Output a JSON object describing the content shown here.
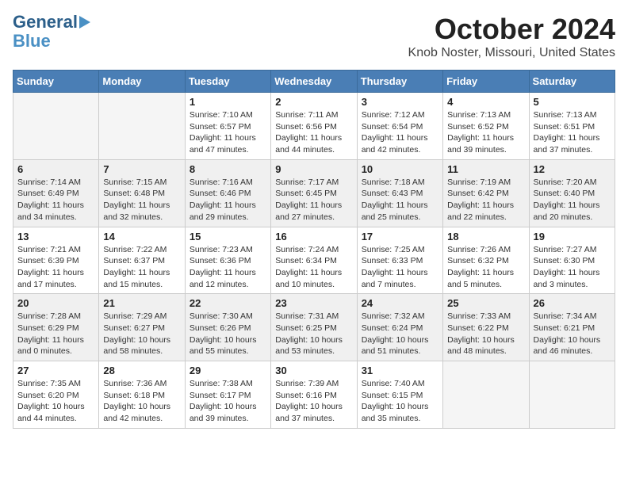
{
  "header": {
    "logo_line1": "General",
    "logo_line2": "Blue",
    "month": "October 2024",
    "location": "Knob Noster, Missouri, United States"
  },
  "days_of_week": [
    "Sunday",
    "Monday",
    "Tuesday",
    "Wednesday",
    "Thursday",
    "Friday",
    "Saturday"
  ],
  "weeks": [
    {
      "shaded": false,
      "days": [
        {
          "num": "",
          "info": ""
        },
        {
          "num": "",
          "info": ""
        },
        {
          "num": "1",
          "info": "Sunrise: 7:10 AM\nSunset: 6:57 PM\nDaylight: 11 hours\nand 47 minutes."
        },
        {
          "num": "2",
          "info": "Sunrise: 7:11 AM\nSunset: 6:56 PM\nDaylight: 11 hours\nand 44 minutes."
        },
        {
          "num": "3",
          "info": "Sunrise: 7:12 AM\nSunset: 6:54 PM\nDaylight: 11 hours\nand 42 minutes."
        },
        {
          "num": "4",
          "info": "Sunrise: 7:13 AM\nSunset: 6:52 PM\nDaylight: 11 hours\nand 39 minutes."
        },
        {
          "num": "5",
          "info": "Sunrise: 7:13 AM\nSunset: 6:51 PM\nDaylight: 11 hours\nand 37 minutes."
        }
      ]
    },
    {
      "shaded": true,
      "days": [
        {
          "num": "6",
          "info": "Sunrise: 7:14 AM\nSunset: 6:49 PM\nDaylight: 11 hours\nand 34 minutes."
        },
        {
          "num": "7",
          "info": "Sunrise: 7:15 AM\nSunset: 6:48 PM\nDaylight: 11 hours\nand 32 minutes."
        },
        {
          "num": "8",
          "info": "Sunrise: 7:16 AM\nSunset: 6:46 PM\nDaylight: 11 hours\nand 29 minutes."
        },
        {
          "num": "9",
          "info": "Sunrise: 7:17 AM\nSunset: 6:45 PM\nDaylight: 11 hours\nand 27 minutes."
        },
        {
          "num": "10",
          "info": "Sunrise: 7:18 AM\nSunset: 6:43 PM\nDaylight: 11 hours\nand 25 minutes."
        },
        {
          "num": "11",
          "info": "Sunrise: 7:19 AM\nSunset: 6:42 PM\nDaylight: 11 hours\nand 22 minutes."
        },
        {
          "num": "12",
          "info": "Sunrise: 7:20 AM\nSunset: 6:40 PM\nDaylight: 11 hours\nand 20 minutes."
        }
      ]
    },
    {
      "shaded": false,
      "days": [
        {
          "num": "13",
          "info": "Sunrise: 7:21 AM\nSunset: 6:39 PM\nDaylight: 11 hours\nand 17 minutes."
        },
        {
          "num": "14",
          "info": "Sunrise: 7:22 AM\nSunset: 6:37 PM\nDaylight: 11 hours\nand 15 minutes."
        },
        {
          "num": "15",
          "info": "Sunrise: 7:23 AM\nSunset: 6:36 PM\nDaylight: 11 hours\nand 12 minutes."
        },
        {
          "num": "16",
          "info": "Sunrise: 7:24 AM\nSunset: 6:34 PM\nDaylight: 11 hours\nand 10 minutes."
        },
        {
          "num": "17",
          "info": "Sunrise: 7:25 AM\nSunset: 6:33 PM\nDaylight: 11 hours\nand 7 minutes."
        },
        {
          "num": "18",
          "info": "Sunrise: 7:26 AM\nSunset: 6:32 PM\nDaylight: 11 hours\nand 5 minutes."
        },
        {
          "num": "19",
          "info": "Sunrise: 7:27 AM\nSunset: 6:30 PM\nDaylight: 11 hours\nand 3 minutes."
        }
      ]
    },
    {
      "shaded": true,
      "days": [
        {
          "num": "20",
          "info": "Sunrise: 7:28 AM\nSunset: 6:29 PM\nDaylight: 11 hours\nand 0 minutes."
        },
        {
          "num": "21",
          "info": "Sunrise: 7:29 AM\nSunset: 6:27 PM\nDaylight: 10 hours\nand 58 minutes."
        },
        {
          "num": "22",
          "info": "Sunrise: 7:30 AM\nSunset: 6:26 PM\nDaylight: 10 hours\nand 55 minutes."
        },
        {
          "num": "23",
          "info": "Sunrise: 7:31 AM\nSunset: 6:25 PM\nDaylight: 10 hours\nand 53 minutes."
        },
        {
          "num": "24",
          "info": "Sunrise: 7:32 AM\nSunset: 6:24 PM\nDaylight: 10 hours\nand 51 minutes."
        },
        {
          "num": "25",
          "info": "Sunrise: 7:33 AM\nSunset: 6:22 PM\nDaylight: 10 hours\nand 48 minutes."
        },
        {
          "num": "26",
          "info": "Sunrise: 7:34 AM\nSunset: 6:21 PM\nDaylight: 10 hours\nand 46 minutes."
        }
      ]
    },
    {
      "shaded": false,
      "days": [
        {
          "num": "27",
          "info": "Sunrise: 7:35 AM\nSunset: 6:20 PM\nDaylight: 10 hours\nand 44 minutes."
        },
        {
          "num": "28",
          "info": "Sunrise: 7:36 AM\nSunset: 6:18 PM\nDaylight: 10 hours\nand 42 minutes."
        },
        {
          "num": "29",
          "info": "Sunrise: 7:38 AM\nSunset: 6:17 PM\nDaylight: 10 hours\nand 39 minutes."
        },
        {
          "num": "30",
          "info": "Sunrise: 7:39 AM\nSunset: 6:16 PM\nDaylight: 10 hours\nand 37 minutes."
        },
        {
          "num": "31",
          "info": "Sunrise: 7:40 AM\nSunset: 6:15 PM\nDaylight: 10 hours\nand 35 minutes."
        },
        {
          "num": "",
          "info": ""
        },
        {
          "num": "",
          "info": ""
        }
      ]
    }
  ]
}
